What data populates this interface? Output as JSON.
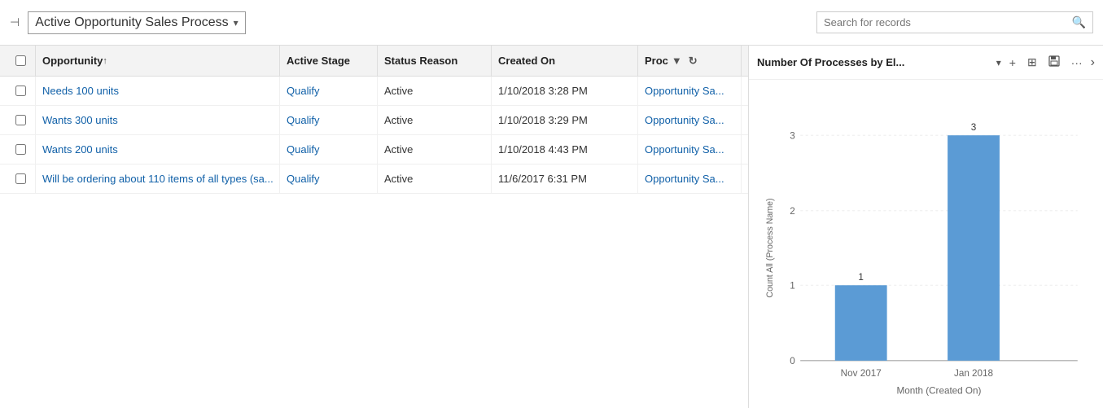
{
  "header": {
    "pin_icon": "📌",
    "title": "Active Opportunity Sales Process",
    "dropdown_arrow": "▾",
    "search_placeholder": "Search for records",
    "search_icon": "🔍"
  },
  "grid": {
    "columns": [
      {
        "id": "opportunity",
        "label": "Opportunity",
        "sort": "↑"
      },
      {
        "id": "active_stage",
        "label": "Active Stage"
      },
      {
        "id": "status_reason",
        "label": "Status Reason"
      },
      {
        "id": "created_on",
        "label": "Created On"
      },
      {
        "id": "process",
        "label": "Proc"
      }
    ],
    "rows": [
      {
        "opportunity": "Needs 100 units",
        "active_stage": "Qualify",
        "status_reason": "Active",
        "created_on": "1/10/2018 3:28 PM",
        "process": "Opportunity Sa..."
      },
      {
        "opportunity": "Wants 300 units",
        "active_stage": "Qualify",
        "status_reason": "Active",
        "created_on": "1/10/2018 3:29 PM",
        "process": "Opportunity Sa..."
      },
      {
        "opportunity": "Wants 200 units",
        "active_stage": "Qualify",
        "status_reason": "Active",
        "created_on": "1/10/2018 4:43 PM",
        "process": "Opportunity Sa..."
      },
      {
        "opportunity": "Will be ordering about 110 items of all types (sa...",
        "active_stage": "Qualify",
        "status_reason": "Active",
        "created_on": "11/6/2017 6:31 PM",
        "process": "Opportunity Sa..."
      }
    ]
  },
  "chart": {
    "title": "Number Of Processes by El...",
    "dropdown_arrow": "▾",
    "toolbar": {
      "add": "+",
      "layout": "▦",
      "save": "💾",
      "more": "···"
    },
    "expand_arrow": "›",
    "y_axis_label": "Count All (Process Name)",
    "x_axis_label": "Month (Created On)",
    "bars": [
      {
        "label": "Nov 2017",
        "value": 1,
        "color": "#5b9bd5"
      },
      {
        "label": "Jan 2018",
        "value": 3,
        "color": "#5b9bd5"
      }
    ],
    "y_max": 3,
    "y_ticks": [
      0,
      1,
      2,
      3
    ]
  }
}
